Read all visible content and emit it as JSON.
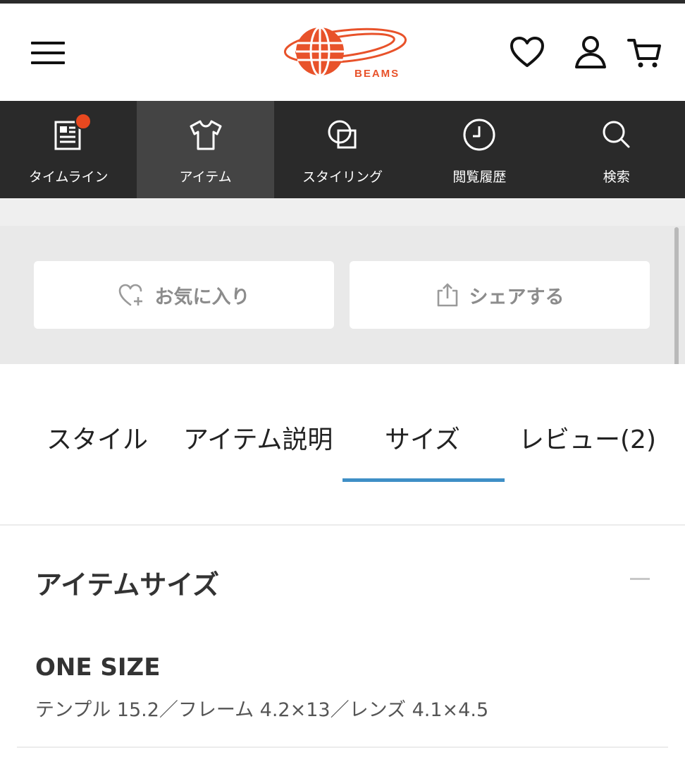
{
  "header": {
    "brand": "BEAMS",
    "brand_color": "#e8522a"
  },
  "nav": {
    "items": [
      {
        "label": "タイムライン",
        "icon": "timeline-icon",
        "badge": true
      },
      {
        "label": "アイテム",
        "icon": "tshirt-icon",
        "active": true
      },
      {
        "label": "スタイリング",
        "icon": "styling-icon"
      },
      {
        "label": "閲覧履歴",
        "icon": "clock-icon"
      },
      {
        "label": "検索",
        "icon": "search-icon"
      }
    ]
  },
  "actions": {
    "favorite_label": "お気に入り",
    "share_label": "シェアする"
  },
  "tabs": [
    {
      "label": "スタイル"
    },
    {
      "label": "アイテム説明"
    },
    {
      "label": "サイズ",
      "active": true
    },
    {
      "label": "レビュー(2)"
    }
  ],
  "tab_accent": "#3f8fc6",
  "size_section": {
    "title": "アイテムサイズ",
    "size_name": "ONE SIZE",
    "detail": "テンプル 15.2／フレーム 4.2×13／レンズ 4.1×4.5"
  }
}
